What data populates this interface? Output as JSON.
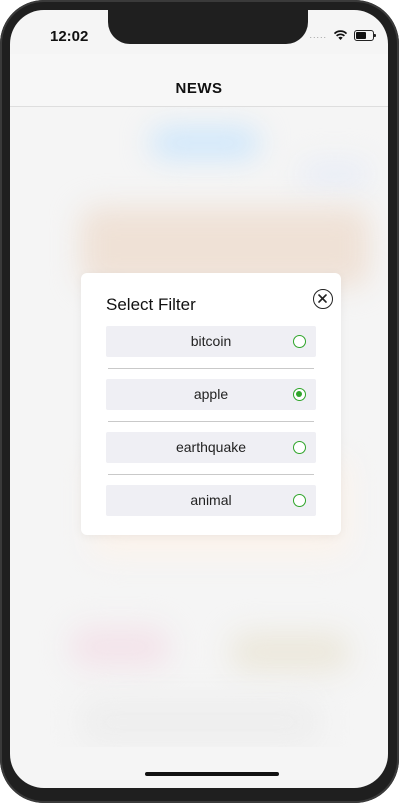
{
  "status_bar": {
    "time": "12:02",
    "signal_dots": "....."
  },
  "nav": {
    "title": "NEWS"
  },
  "filter_modal": {
    "title": "Select Filter",
    "close_icon": "circle-x-icon",
    "options": [
      {
        "label": "bitcoin",
        "selected": false
      },
      {
        "label": "apple",
        "selected": true
      },
      {
        "label": "earthquake",
        "selected": false
      },
      {
        "label": "animal",
        "selected": false
      }
    ]
  },
  "colors": {
    "radio_accent": "#2fa52a",
    "option_background": "#efeff4",
    "device_frame": "#1f1f1f"
  }
}
